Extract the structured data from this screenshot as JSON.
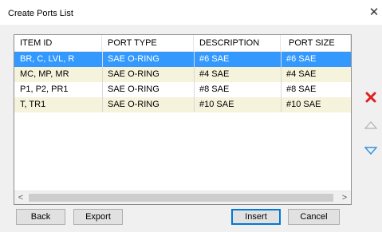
{
  "window": {
    "title": "Create Ports List",
    "close_glyph": "✕"
  },
  "table": {
    "columns": [
      "ITEM ID",
      "PORT TYPE",
      "DESCRIPTION",
      "PORT SIZE"
    ],
    "rows": [
      [
        "BR, C, LVL, R",
        "SAE O-RING",
        "#6 SAE",
        "#6 SAE"
      ],
      [
        "MC, MP, MR",
        "SAE O-RING",
        "#4 SAE",
        "#4 SAE"
      ],
      [
        "P1, P2, PR1",
        "SAE O-RING",
        "#8 SAE",
        "#8 SAE"
      ],
      [
        "T, TR1",
        "SAE O-RING",
        "#10 SAE",
        "#10 SAE"
      ]
    ],
    "selected_row": 0
  },
  "scrollbar": {
    "left_arrow": "<",
    "right_arrow": ">"
  },
  "side_buttons": {
    "delete_icon": "delete-x-icon",
    "up_icon": "move-up-icon",
    "down_icon": "move-down-icon"
  },
  "buttons": {
    "back": "Back",
    "export": "Export",
    "insert": "Insert",
    "cancel": "Cancel"
  },
  "colors": {
    "selection": "#3399ff",
    "alt_row": "#f5f3dc",
    "delete_red": "#e02020",
    "arrow_blue": "#3a8fd6"
  }
}
